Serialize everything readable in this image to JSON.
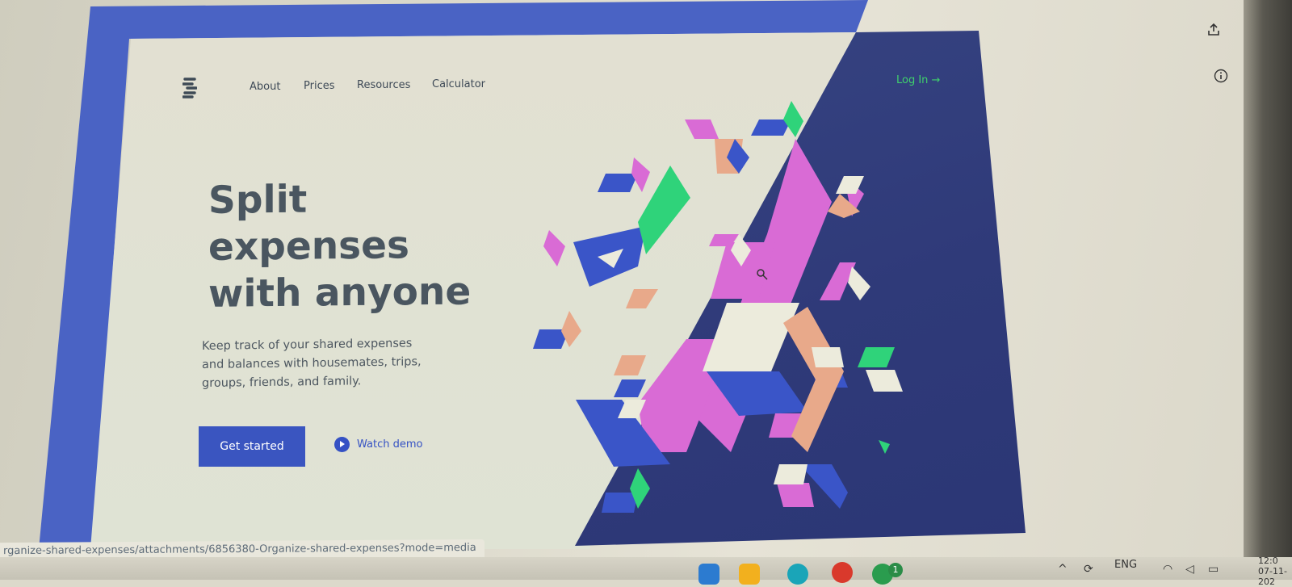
{
  "nav": {
    "items": [
      "About",
      "Prices",
      "Resources",
      "Calculator"
    ],
    "login_label": "Log In →"
  },
  "hero": {
    "title_lines": [
      "Split",
      "expenses",
      "with anyone"
    ],
    "subtitle_lines": [
      "Keep track of your shared expenses",
      "and balances with housemates, trips,",
      "groups, friends, and family."
    ],
    "primary_button": "Get started",
    "secondary_button": "Watch demo"
  },
  "status_bar": {
    "url": "rganize-shared-expenses/attachments/6856380-Organize-shared-expenses?mode=media"
  },
  "taskbar": {
    "language": "ENG",
    "notification_badge": "1",
    "clock_time": "12:0",
    "clock_date": "07-11-202"
  },
  "colors": {
    "brand_blue": "#3a55c0",
    "accent_green": "#3fd16c",
    "magenta": "#d96bd5",
    "peach": "#e8a98a",
    "dark_navy": "#2f3a79"
  },
  "icons": {
    "logo": "dollar-s-logo",
    "play": "play-circle-icon",
    "share": "share-icon",
    "info": "info-icon"
  }
}
